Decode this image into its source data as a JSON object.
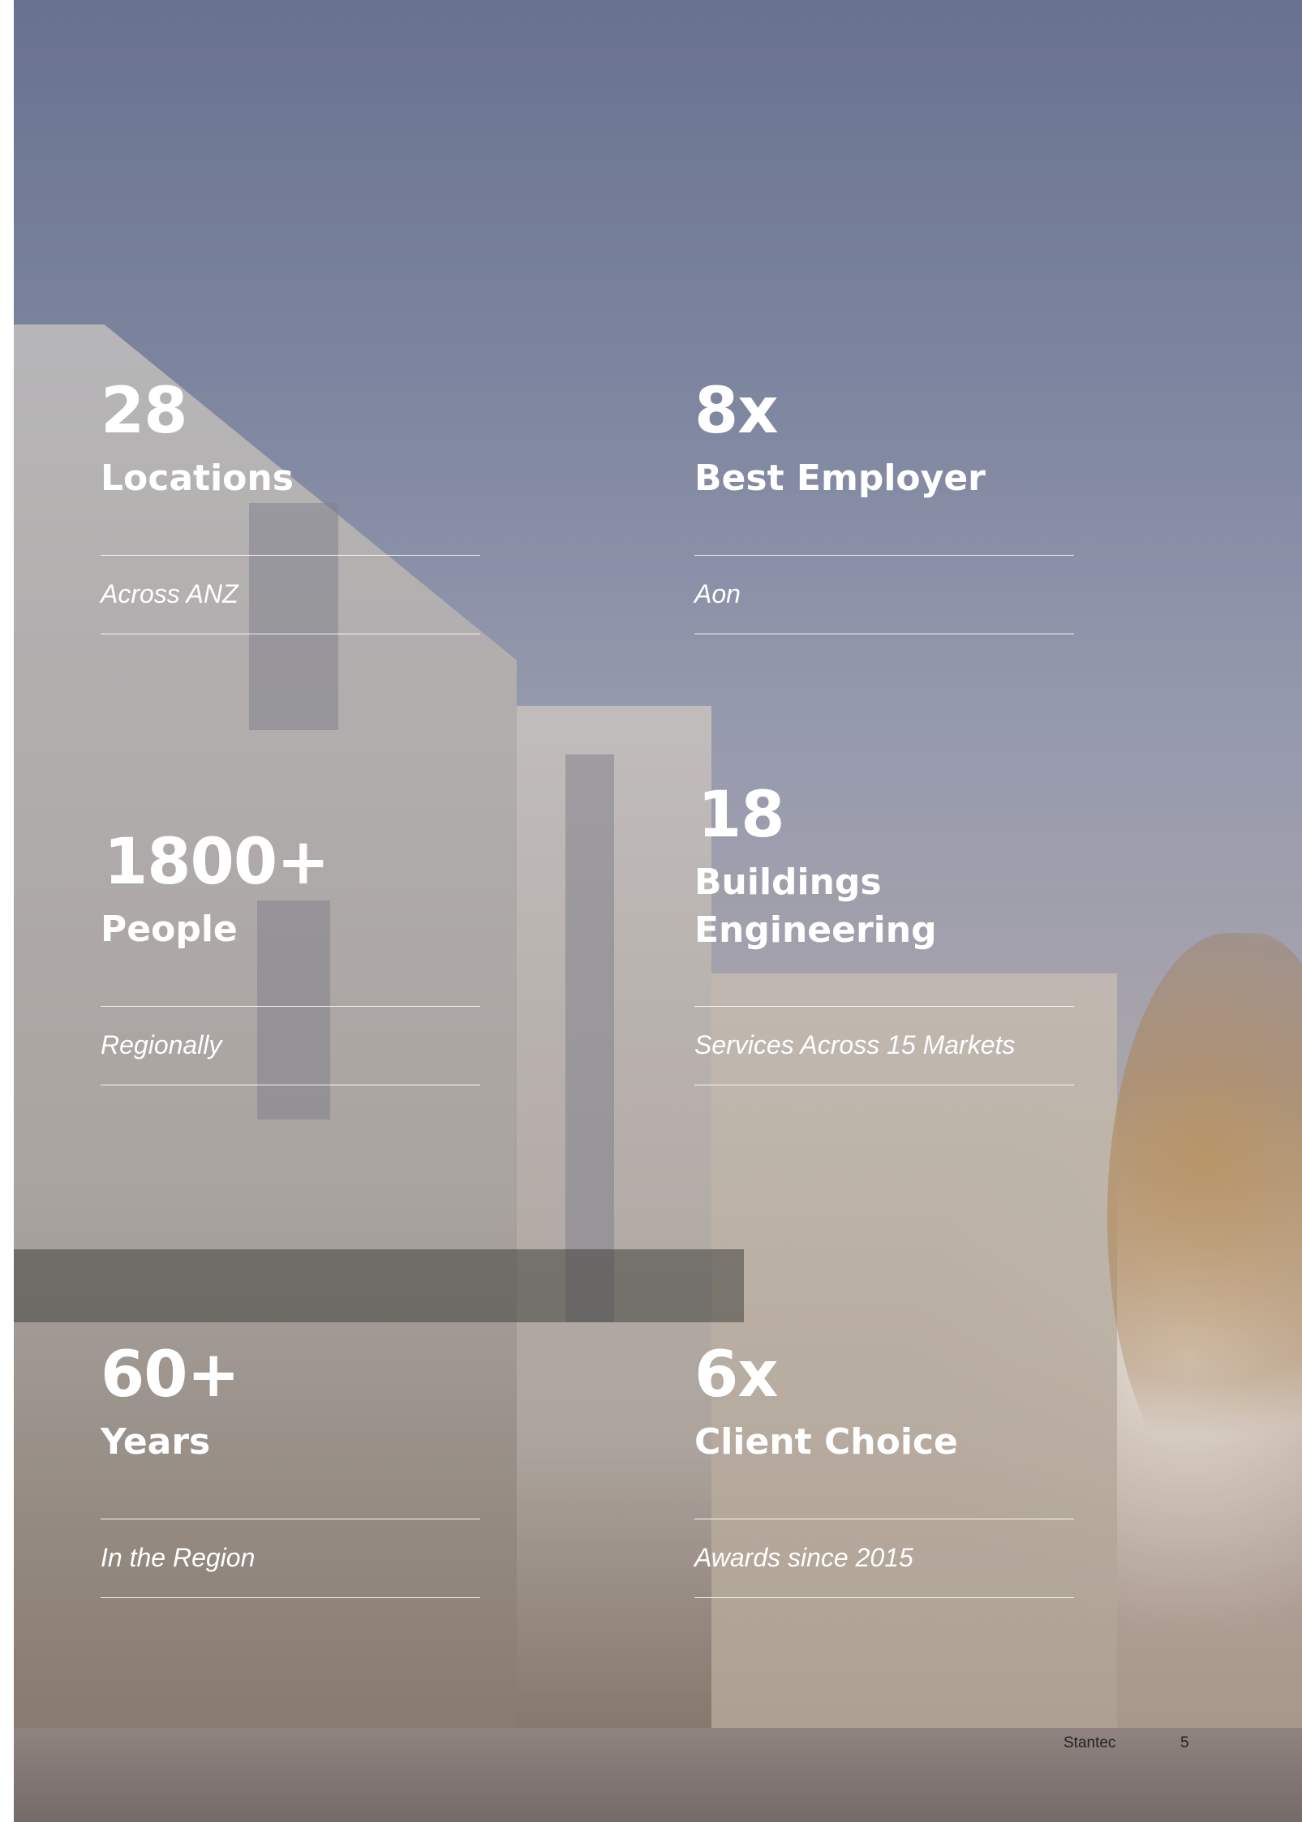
{
  "stats": [
    {
      "number": "28",
      "label_lines": [
        "Locations"
      ],
      "sub": "Across ANZ"
    },
    {
      "number": "8x",
      "label_lines": [
        "Best Employer"
      ],
      "sub": "Aon"
    },
    {
      "number": "1800+",
      "label_lines": [
        "People"
      ],
      "sub": "Regionally"
    },
    {
      "number": "18",
      "label_lines": [
        "Buildings",
        "Engineering"
      ],
      "sub": "Services Across 15 Markets"
    },
    {
      "number": "60+",
      "label_lines": [
        "Years"
      ],
      "sub": "In the Region"
    },
    {
      "number": "6x",
      "label_lines": [
        "Client Choice"
      ],
      "sub": "Awards since 2015"
    }
  ],
  "footer": {
    "brand": "Stantec",
    "page_number": "5"
  }
}
